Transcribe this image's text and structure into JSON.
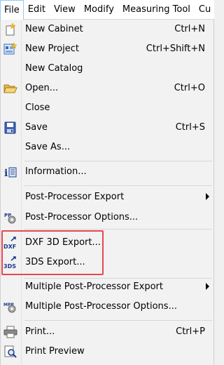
{
  "menubar": {
    "items": [
      "File",
      "Edit",
      "View",
      "Modify",
      "Measuring Tool",
      "Cu"
    ]
  },
  "menu": {
    "new_cabinet": {
      "label": "New Cabinet",
      "shortcut": "Ctrl+N"
    },
    "new_project": {
      "label": "New Project",
      "shortcut": "Ctrl+Shift+N"
    },
    "new_catalog": {
      "label": "New Catalog"
    },
    "open": {
      "label": "Open...",
      "shortcut": "Ctrl+O"
    },
    "close": {
      "label": "Close"
    },
    "save": {
      "label": "Save",
      "shortcut": "Ctrl+S"
    },
    "save_as": {
      "label": "Save As..."
    },
    "information": {
      "label": "Information..."
    },
    "pp_export": {
      "label": "Post-Processor Export"
    },
    "pp_options": {
      "label": "Post-Processor Options..."
    },
    "dxf_export": {
      "label": "DXF 3D Export..."
    },
    "tds_export": {
      "label": "3DS Export..."
    },
    "mpp_export": {
      "label": "Multiple Post-Processor Export"
    },
    "mpp_options": {
      "label": "Multiple Post-Processor Options..."
    },
    "print": {
      "label": "Print...",
      "shortcut": "Ctrl+P"
    },
    "print_preview": {
      "label": "Print Preview"
    }
  },
  "icons": {
    "dxf_text": "DXF",
    "tds_text": "3DS",
    "pp_text": "PP",
    "mpp_text": "MPP"
  },
  "colors": {
    "highlight_border": "#e8484e",
    "menubar_bg": "#ffffff",
    "menu_bg": "#f2f2f2"
  }
}
